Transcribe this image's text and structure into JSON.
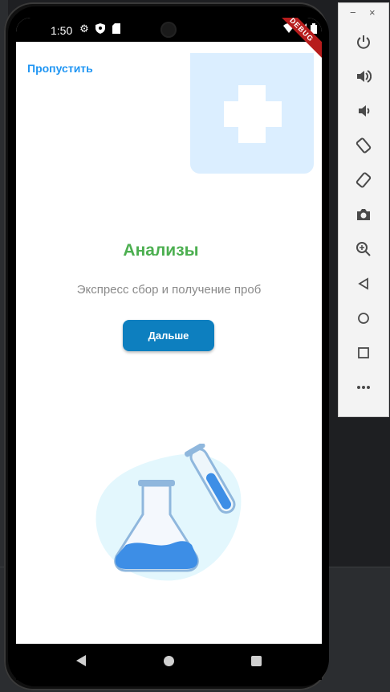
{
  "status_bar": {
    "time": "1:50",
    "debug_banner": "DEBUG"
  },
  "onboarding": {
    "skip_label": "Пропустить",
    "title": "Анализы",
    "subtitle": "Экспресс сбор и получение проб",
    "next_label": "Дальше"
  },
  "emulator": {
    "minimize": "−",
    "close": "×",
    "buttons": [
      "power-icon",
      "volume-up-icon",
      "volume-down-icon",
      "rotate-left-icon",
      "rotate-right-icon",
      "camera-icon",
      "zoom-icon",
      "back-icon",
      "home-icon",
      "overview-icon",
      "more-icon"
    ]
  },
  "colors": {
    "accent_blue": "#2196f3",
    "title_green": "#4caf50",
    "button_blue": "#0d7fbf",
    "plus_card": "#dbeeff"
  }
}
